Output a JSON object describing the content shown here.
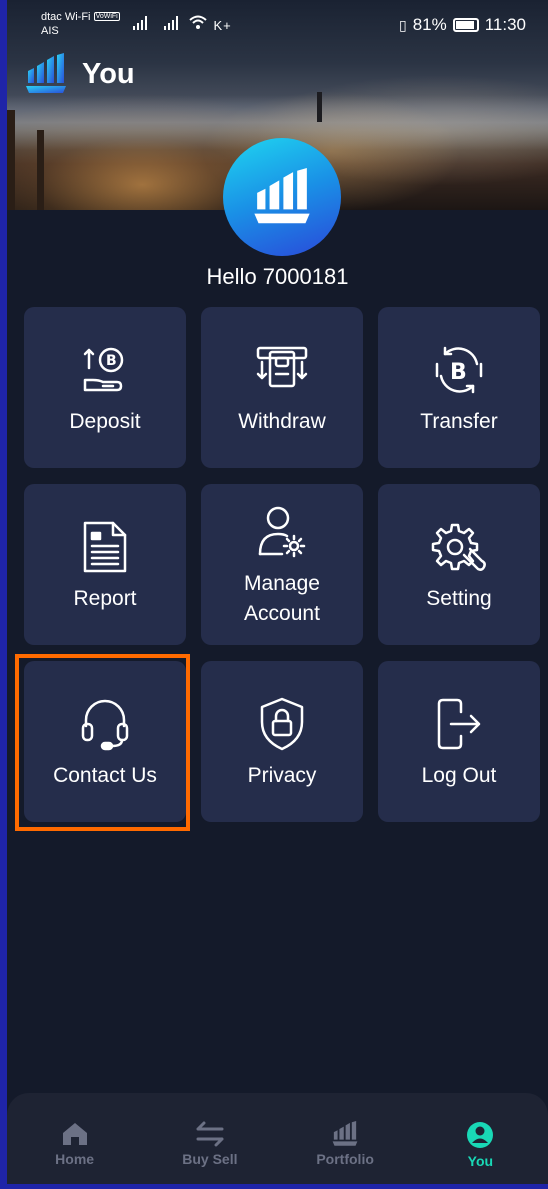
{
  "status_bar": {
    "carrier_line1": "dtac Wi-Fi",
    "carrier_badge": "VoWiFi",
    "carrier_line2": "AIS",
    "network": "K+",
    "battery": "81%",
    "time": "11:30"
  },
  "header": {
    "title": "You",
    "logo_icon": "company-logo-icon"
  },
  "profile": {
    "greeting": "Hello 7000181"
  },
  "menu": {
    "deposit": {
      "label": "Deposit",
      "icon": "bitcoin-deposit-icon"
    },
    "withdraw": {
      "label": "Withdraw",
      "icon": "atm-withdraw-icon"
    },
    "transfer": {
      "label": "Transfer",
      "icon": "bitcoin-transfer-icon"
    },
    "report": {
      "label": "Report",
      "icon": "document-icon"
    },
    "manage_line1": "Manage",
    "manage_line2": "Account",
    "setting": {
      "label": "Setting",
      "icon": "gear-wrench-icon"
    },
    "contact": {
      "label": "Contact Us",
      "icon": "headset-icon"
    },
    "privacy": {
      "label": "Privacy",
      "icon": "shield-lock-icon"
    },
    "logout": {
      "label": "Log Out",
      "icon": "logout-icon"
    }
  },
  "bottom_nav": {
    "home": "Home",
    "buysell": "Buy Sell",
    "portfolio": "Portfolio",
    "you": "You"
  },
  "colors": {
    "background": "#141a2a",
    "tile": "#252d4b",
    "active_nav": "#19d8b6",
    "highlight": "#ff6a00"
  }
}
